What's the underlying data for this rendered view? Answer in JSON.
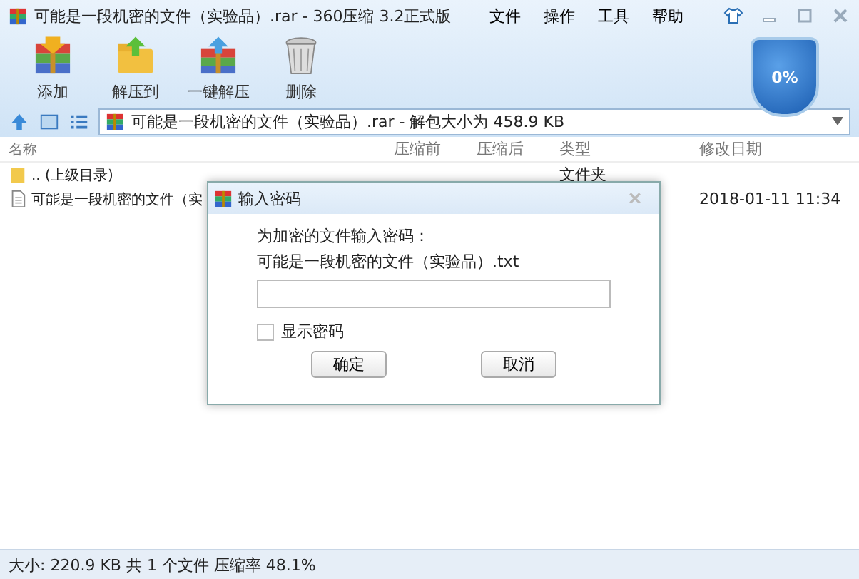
{
  "window": {
    "title": "可能是一段机密的文件（实验品）.rar - 360压缩 3.2正式版"
  },
  "menu": [
    "文件",
    "操作",
    "工具",
    "帮助"
  ],
  "toolbar": [
    {
      "label": "添加",
      "kind": "add"
    },
    {
      "label": "解压到",
      "kind": "extract"
    },
    {
      "label": "一键解压",
      "kind": "onekey"
    },
    {
      "label": "删除",
      "kind": "delete"
    }
  ],
  "shield": {
    "text": "0%"
  },
  "address": {
    "value": "可能是一段机密的文件（实验品）.rar - 解包大小为 458.9 KB"
  },
  "table": {
    "columns": [
      "名称",
      "压缩前",
      "压缩后",
      "类型",
      "修改日期"
    ],
    "rows": [
      {
        "kind": "folder",
        "name": ".. (上级目录)",
        "type": "文件夹",
        "date": ""
      },
      {
        "kind": "file",
        "name": "可能是一段机密的文件（实",
        "type": "",
        "date": "2018-01-11 11:34"
      }
    ]
  },
  "dialog": {
    "title": "输入密码",
    "prompt": "为加密的文件输入密码：",
    "filename": "可能是一段机密的文件（实验品）.txt",
    "show_password": {
      "label": "显示密码",
      "checked": false
    },
    "buttons": [
      "确定",
      "取消"
    ]
  },
  "status_bar": "大小: 220.9 KB 共 1 个文件 压缩率 48.1%"
}
